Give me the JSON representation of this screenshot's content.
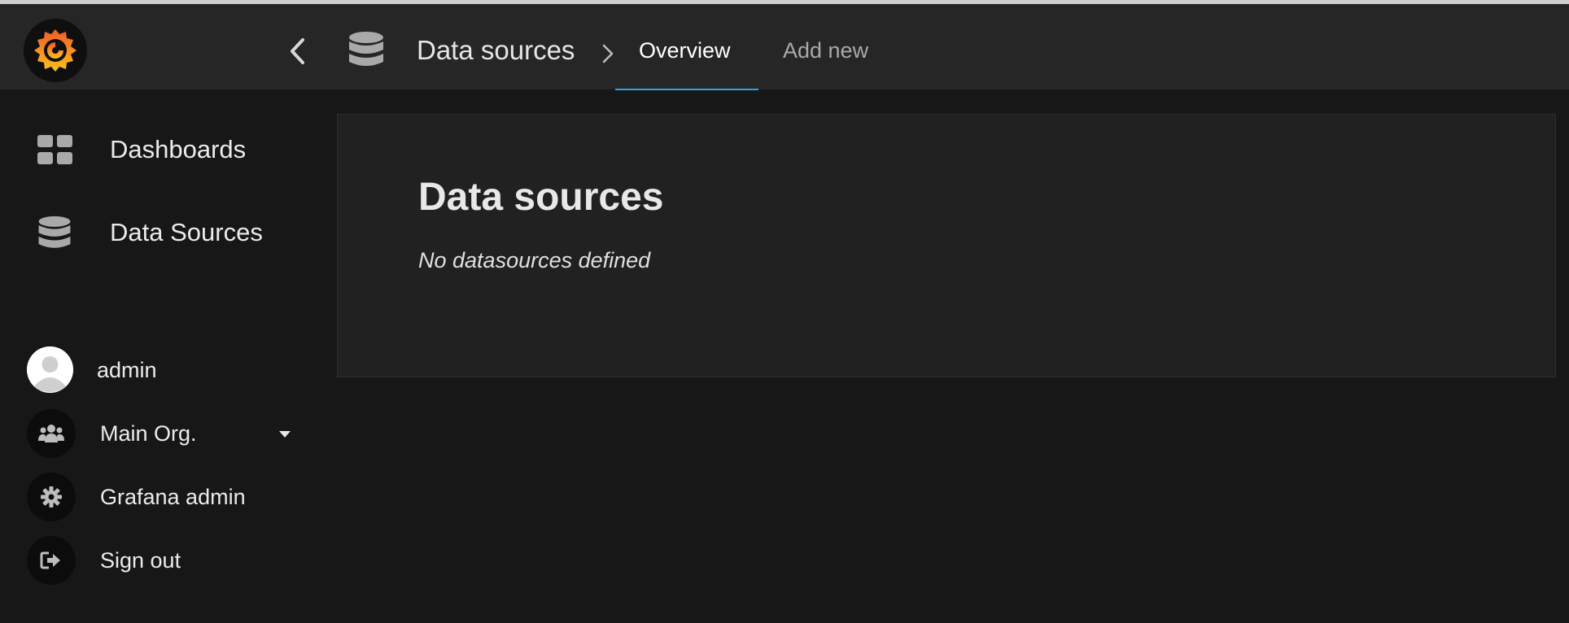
{
  "topbar": {
    "breadcrumb_title": "Data sources",
    "tabs": [
      {
        "label": "Overview",
        "active": true
      },
      {
        "label": "Add new",
        "active": false
      }
    ]
  },
  "sidebar": {
    "nav": [
      {
        "label": "Dashboards",
        "icon": "dashboards-grid-icon"
      },
      {
        "label": "Data Sources",
        "icon": "database-icon"
      }
    ],
    "user_menu": [
      {
        "label": "admin",
        "icon": "avatar"
      },
      {
        "label": "Main Org.",
        "icon": "users-icon"
      },
      {
        "label": "Grafana admin",
        "icon": "gear-icon"
      },
      {
        "label": "Sign out",
        "icon": "sign-out-icon"
      }
    ]
  },
  "main": {
    "title": "Data sources",
    "empty_message": "No datasources defined"
  },
  "colors": {
    "accent": "#33a2e5",
    "topbar_bg": "#262626",
    "page_bg": "#171717",
    "panel_bg": "#212121"
  }
}
